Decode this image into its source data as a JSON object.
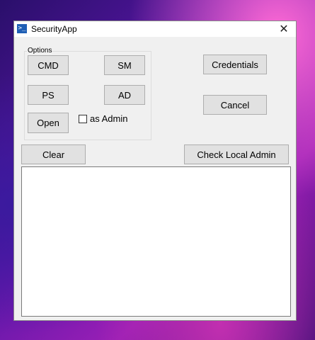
{
  "window": {
    "title": "SecurityApp",
    "close_glyph": "✕",
    "icon": "powershell-icon"
  },
  "options_group": {
    "label": "Options",
    "buttons": {
      "cmd": "CMD",
      "sm": "SM",
      "ps": "PS",
      "ad": "AD",
      "open": "Open"
    },
    "as_admin": {
      "label": "as Admin",
      "checked": false
    }
  },
  "actions": {
    "credentials": "Credentials",
    "cancel": "Cancel",
    "clear": "Clear",
    "check_local_admin": "Check Local Admin"
  },
  "output": {
    "text": ""
  },
  "colors": {
    "window_bg": "#f0f0f0",
    "button_bg": "#e1e1e1",
    "button_border": "#adadad",
    "icon_bg": "#1f5fb5"
  }
}
